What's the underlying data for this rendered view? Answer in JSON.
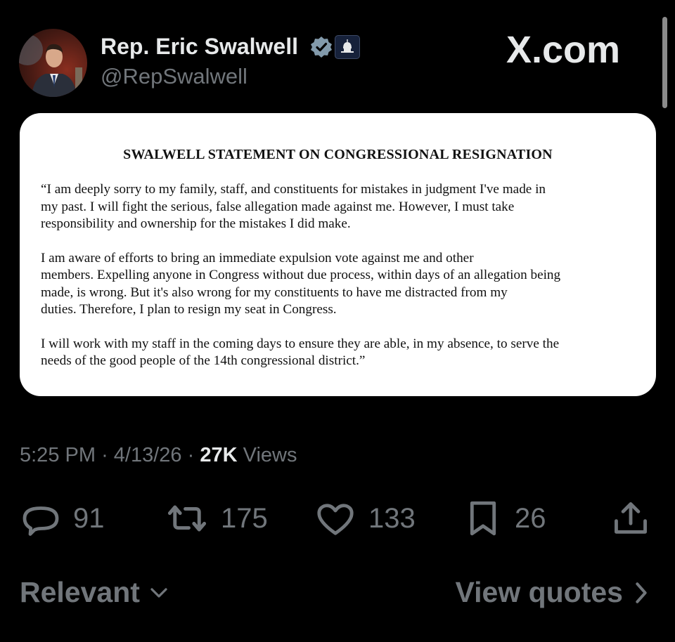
{
  "author": {
    "display_name": "Rep. Eric Swalwell",
    "handle": "@RepSwalwell",
    "verified_icon": "verified-badge-icon",
    "affiliation_icon": "capitol-building-icon"
  },
  "site_logo": "X.com",
  "statement": {
    "title": "SWALWELL STATEMENT ON CONGRESSIONAL RESIGNATION",
    "paragraphs": [
      "“I am deeply sorry to my family, staff, and constituents for mistakes in judgment I've made in\nmy past.  I will fight the serious, false allegation made against me. However, I must take\nresponsibility and ownership for the mistakes I did make.",
      "I am aware of efforts to bring an immediate expulsion vote against me and other\nmembers.  Expelling anyone in Congress without due process, within days of an allegation being\nmade, is wrong.  But it's also wrong for my constituents to have me distracted from my\nduties.  Therefore, I plan to resign my seat in Congress.",
      "I will work with my staff in the coming days to ensure they are able, in my absence, to serve the\nneeds of the good people of the 14th congressional district.”"
    ]
  },
  "meta": {
    "time": "5:25 PM",
    "date": "4/13/26",
    "separator": "·",
    "views_count": "27K",
    "views_label": "Views"
  },
  "actions": {
    "replies": "91",
    "reposts": "175",
    "likes": "133",
    "bookmarks": "26"
  },
  "bottom": {
    "filter_label": "Relevant",
    "quotes_label": "View quotes"
  },
  "colors": {
    "background": "#000000",
    "primary_text": "#e7e9ea",
    "secondary_text": "#71767b",
    "verified": "#829aab",
    "card": "#ffffff"
  }
}
